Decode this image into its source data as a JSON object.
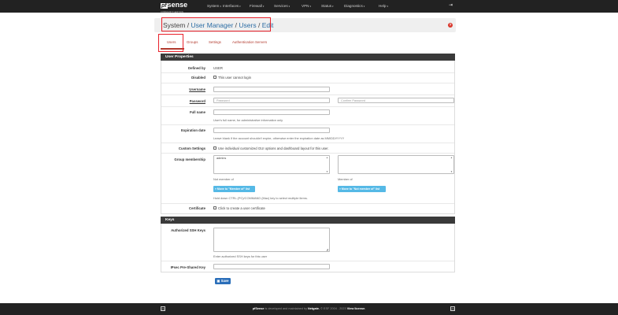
{
  "header": {
    "logo": "sense",
    "logo_prefix": "pf",
    "logo_sub": "COMMUNITY EDITION",
    "menu": [
      "System",
      "Interfaces",
      "Firewall",
      "Services",
      "VPN",
      "Status",
      "Diagnostics",
      "Help"
    ],
    "logout_icon": "logout-icon"
  },
  "breadcrumb": {
    "parts": [
      "System",
      "User Manager",
      "Users",
      "Edit"
    ],
    "sep": " / "
  },
  "tabs": [
    "Users",
    "Groups",
    "Settings",
    "Authentication Servers"
  ],
  "user_properties": {
    "title": "User Properties",
    "defined_by_label": "Defined by",
    "defined_by_value": "USER",
    "disabled_label": "Disabled",
    "disabled_text": "This user cannot login",
    "username_label": "Username",
    "username_value": "",
    "password_label": "Password",
    "password_placeholder": "Password",
    "confirm_placeholder": "Confirm Password",
    "fullname_label": "Full name",
    "fullname_help": "User's full name, for administrative information only",
    "expiration_label": "Expiration date",
    "expiration_help": "Leave blank if the account shouldn't expire, otherwise enter the expiration date as MM/DD/YYYY",
    "custom_label": "Custom Settings",
    "custom_text": "Use individual customized GUI options and dashboard layout for this user.",
    "group_label": "Group membership",
    "not_member_options": [
      "admins"
    ],
    "not_member_caption": "Not member of",
    "member_caption": "Member of",
    "move_to_member": "Move to \"Member of\" list",
    "move_to_not_member": "Move to \"Not member of\" list",
    "group_help": "Hold down CTRL (PC)/COMMAND (Mac) key to select multiple items.",
    "certificate_label": "Certificate",
    "certificate_text": "Click to create a user certificate"
  },
  "keys": {
    "title": "Keys",
    "ssh_label": "Authorized SSH Keys",
    "ssh_help": "Enter authorized SSH keys for this user",
    "psk_label": "IPsec Pre-Shared Key"
  },
  "save_label": "Save",
  "footer": {
    "brand": "pfSense",
    "text1": " is developed and maintained by ",
    "company": "Netgate.",
    "text2": " © ESF 2004 - 2023 ",
    "license": "View license."
  },
  "colors": {
    "nav_bg": "#222222",
    "link": "#2c6ea5",
    "tab_active": "#b23b2f",
    "highlight": "#e8202a",
    "save_btn": "#2a6eb9",
    "move_btn": "#55b9e6"
  }
}
